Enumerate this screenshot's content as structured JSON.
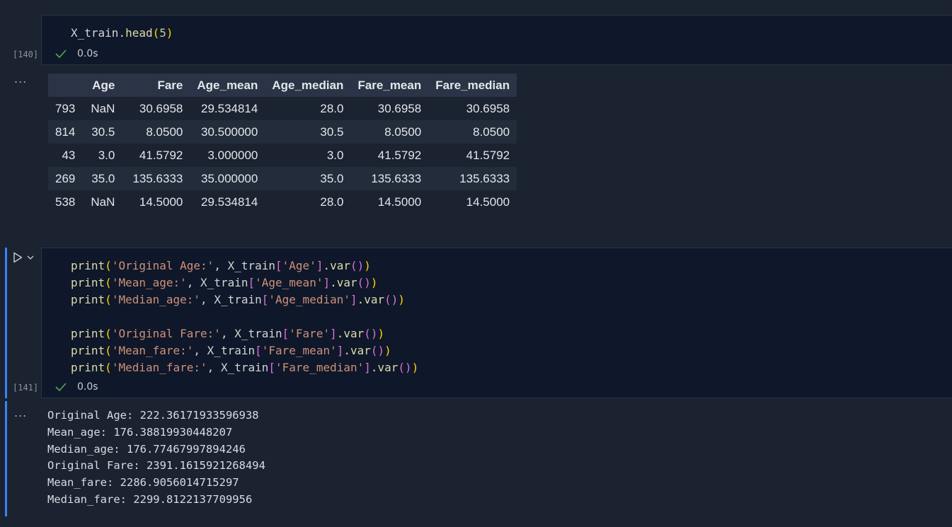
{
  "cell1": {
    "exec_count": "[140]",
    "code": {
      "obj": "X_train",
      "method": ".head",
      "open": "(",
      "arg": "5",
      "close": ")"
    },
    "status_time": "0.0s"
  },
  "output1": {
    "ellipsis": "...",
    "table": {
      "columns": [
        "",
        "Age",
        "Fare",
        "Age_mean",
        "Age_median",
        "Fare_mean",
        "Fare_median"
      ],
      "rows": [
        [
          "793",
          "NaN",
          "30.6958",
          "29.534814",
          "28.0",
          "30.6958",
          "30.6958"
        ],
        [
          "814",
          "30.5",
          "8.0500",
          "30.500000",
          "30.5",
          "8.0500",
          "8.0500"
        ],
        [
          "43",
          "3.0",
          "41.5792",
          "3.000000",
          "3.0",
          "41.5792",
          "41.5792"
        ],
        [
          "269",
          "35.0",
          "135.6333",
          "35.000000",
          "35.0",
          "135.6333",
          "135.6333"
        ],
        [
          "538",
          "NaN",
          "14.5000",
          "29.534814",
          "28.0",
          "14.5000",
          "14.5000"
        ]
      ]
    }
  },
  "cell2": {
    "exec_count": "[141]",
    "lines": [
      {
        "label": "'Original Age:'",
        "col": "'Age'"
      },
      {
        "label": "'Mean_age:'",
        "col": "'Age_mean'"
      },
      {
        "label": "'Median_age:'",
        "col": "'Age_median'"
      },
      {
        "label": "'Original Fare:'",
        "col": "'Fare'"
      },
      {
        "label": "'Mean_fare:'",
        "col": "'Fare_mean'"
      },
      {
        "label": "'Median_fare:'",
        "col": "'Fare_median'"
      }
    ],
    "fn": "print",
    "obj": "X_train",
    "method": ".var",
    "status_time": "0.0s"
  },
  "output2": {
    "ellipsis": "...",
    "lines": [
      "Original Age: 222.36171933596938",
      "Mean_age: 176.38819930448207",
      "Median_age: 176.77467997894246",
      "Original Fare: 2391.1615921268494",
      "Mean_fare: 2286.9056014715297",
      "Median_fare: 2299.8122137709956"
    ]
  },
  "icons": {
    "run": "play-icon",
    "chevron": "chevron-down-icon",
    "check": "check-icon"
  },
  "colors": {
    "accent_bar": "#3b82f6",
    "success_check": "#4caf50"
  }
}
